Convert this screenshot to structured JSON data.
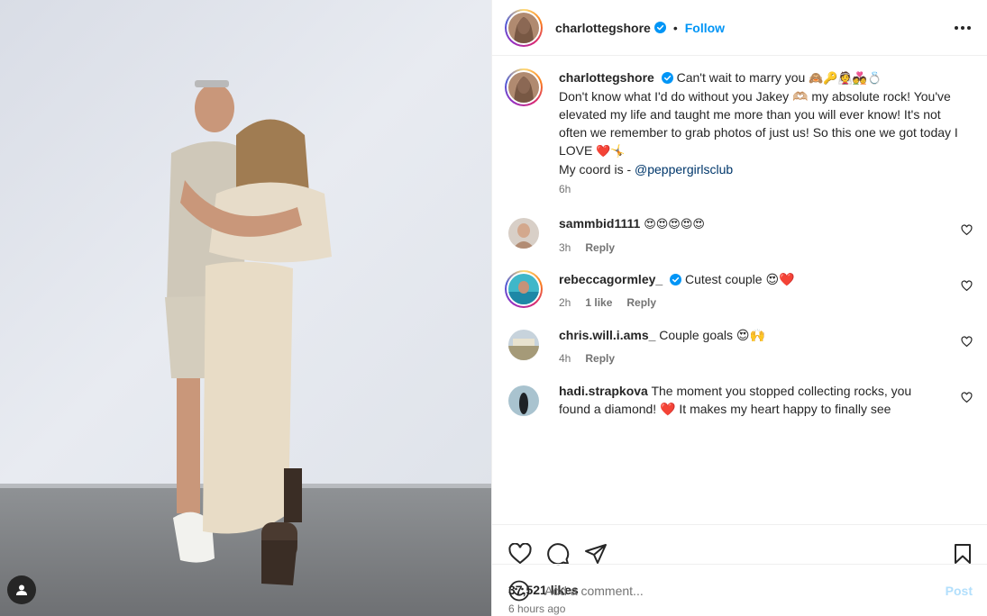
{
  "post": {
    "username": "charlottegshore",
    "follow_label": "Follow",
    "dot": "•"
  },
  "caption": {
    "username": "charlottegshore",
    "line1": "Can't wait to marry you",
    "emoji1": "🙈🔑👰💑💍",
    "text": "Don't know what I'd do without you Jakey 🫶🏼 my absolute rock! You've elevated my life and taught me more than you will ever know! It's not often we remember to grab photos of just us! So this one we got today I LOVE",
    "emoji2": "❤️🤸",
    "coord_prefix": "My coord is - ",
    "mention": "@peppergirlsclub",
    "time": "6h"
  },
  "comments": [
    {
      "username": "sammbid1111",
      "text": "😍😍😍😍😍",
      "time": "3h",
      "likes": "",
      "reply": "Reply",
      "verified": false
    },
    {
      "username": "rebeccagormley_",
      "text": "Cutest couple 😍❤️",
      "time": "2h",
      "likes": "1 like",
      "reply": "Reply",
      "verified": true
    },
    {
      "username": "chris.will.i.ams_",
      "text": "Couple goals 😍🙌",
      "time": "4h",
      "likes": "",
      "reply": "Reply",
      "verified": false
    },
    {
      "username": "hadi.strapkova",
      "text": "The moment you stopped collecting rocks, you found a diamond! ❤️ It makes my heart happy to finally see",
      "time": "",
      "likes": "",
      "reply": "",
      "verified": false
    }
  ],
  "stats": {
    "likes": "37,521 likes",
    "ago": "6 hours ago"
  },
  "composer": {
    "placeholder": "Add a comment...",
    "post_label": "Post"
  },
  "icons": {
    "tag": "user-tag-icon",
    "verified": "verified-badge-icon",
    "more": "more-options-icon",
    "like": "heart-icon",
    "comment": "comment-icon",
    "share": "share-icon",
    "save": "bookmark-icon",
    "emoji": "emoji-icon"
  },
  "colors": {
    "accent": "#0095f6",
    "post_disabled": "#b2dffc",
    "muted": "#737373",
    "mention": "#00376b"
  }
}
